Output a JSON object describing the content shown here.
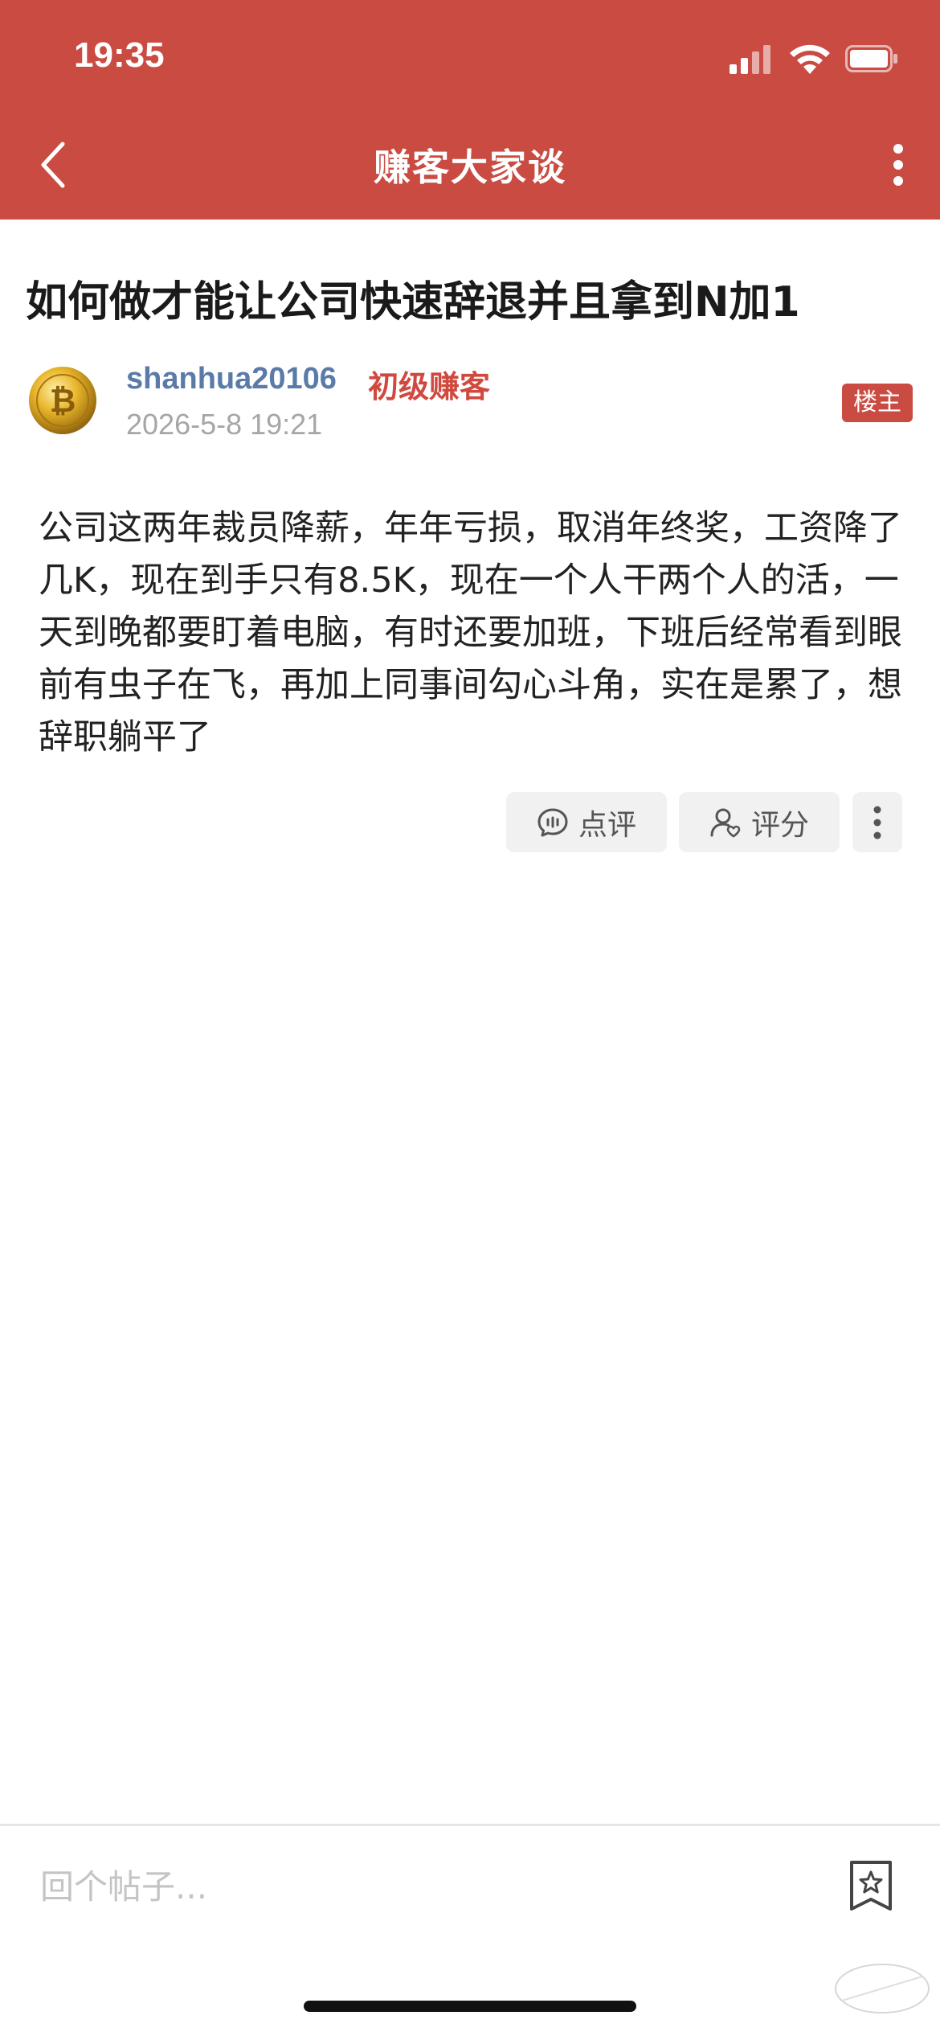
{
  "status_bar": {
    "time": "19:35"
  },
  "nav": {
    "title": "赚客大家谈",
    "back_icon": "chevron-left-icon",
    "more_icon": "more-vertical-icon"
  },
  "post": {
    "title": "如何做才能让公司快速辞退并且拿到N加1",
    "author": {
      "username": "shanhua20106",
      "level": "初级赚客",
      "avatar_icon": "bitcoin-coin-avatar"
    },
    "time": "2026-5-8 19:21",
    "op_badge": "楼主",
    "body": "公司这两年裁员降薪，年年亏损，取消年终奖，工资降了几K，现在到手只有8.5K，现在一个人干两个人的活，一天到晚都要盯着电脑，有时还要加班，下班后经常看到眼前有虫子在飞，再加上同事间勾心斗角，实在是累了，想辞职躺平了",
    "actions": {
      "comment_label": "点评",
      "rate_label": "评分"
    }
  },
  "reply_bar": {
    "placeholder": "回个帖子..."
  },
  "colors": {
    "header_bg": "#c94b42",
    "username": "#5a7aa8",
    "level": "#d0493e",
    "badge_bg": "#c94b42"
  }
}
